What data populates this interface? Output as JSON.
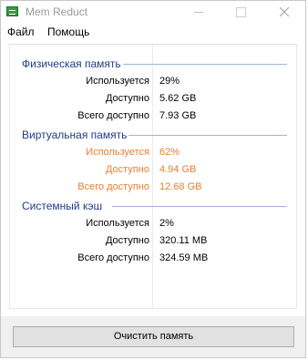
{
  "window": {
    "title": "Mem Reduct"
  },
  "menu": {
    "file": "Файл",
    "help": "Помощь"
  },
  "groups": {
    "physical": {
      "title": "Физическая память",
      "rows": [
        {
          "label": "Используется",
          "value": "29%"
        },
        {
          "label": "Доступно",
          "value": "5.62 GB"
        },
        {
          "label": "Всего доступно",
          "value": "7.93 GB"
        }
      ]
    },
    "virtual": {
      "title": "Виртуальная память",
      "rows": [
        {
          "label": "Используется",
          "value": "62%"
        },
        {
          "label": "Доступно",
          "value": "4.94 GB"
        },
        {
          "label": "Всего доступно",
          "value": "12.68 GB"
        }
      ]
    },
    "cache": {
      "title": "Системный кэш",
      "rows": [
        {
          "label": "Используется",
          "value": "2%"
        },
        {
          "label": "Доступно",
          "value": "320.11 MB"
        },
        {
          "label": "Всего доступно",
          "value": "324.59 MB"
        }
      ]
    }
  },
  "colors": {
    "group_title": "#1f3c88",
    "warning": "#ee7d30"
  },
  "icons": {
    "app": "mem-reduct-app-icon",
    "minimize": "minimize-icon",
    "maximize": "maximize-icon",
    "close": "close-icon"
  },
  "actions": {
    "clean_label": "Очистить память"
  }
}
